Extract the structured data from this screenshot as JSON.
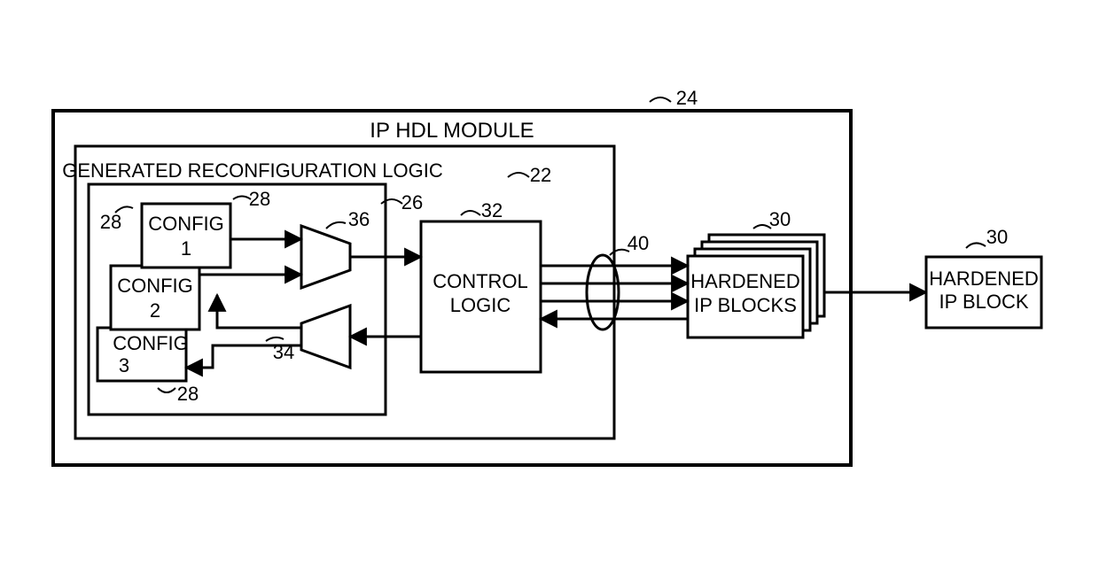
{
  "outer": {
    "title": "IP HDL MODULE",
    "ref": "24"
  },
  "inner": {
    "ref": "22"
  },
  "reconfig": {
    "title": "GENERATED RECONFIGURATION LOGIC",
    "ref": "26"
  },
  "configs": {
    "c1": {
      "line1": "CONFIG",
      "line2": "1",
      "ref": "28"
    },
    "c2": {
      "line1": "CONFIG",
      "line2": "2",
      "ref": "28"
    },
    "c3": {
      "line1": "CONFIG",
      "line2": "3",
      "ref": "28"
    }
  },
  "mux_top": {
    "ref": "36"
  },
  "mux_bot": {
    "ref": "34"
  },
  "control": {
    "line1": "CONTROL",
    "line2": "LOGIC",
    "ref": "32"
  },
  "bus": {
    "ref": "40"
  },
  "hardened_stack": {
    "line1": "HARDENED",
    "line2": "IP BLOCKS",
    "ref": "30"
  },
  "hardened_ext": {
    "line1": "HARDENED",
    "line2": "IP BLOCK",
    "ref": "30"
  }
}
